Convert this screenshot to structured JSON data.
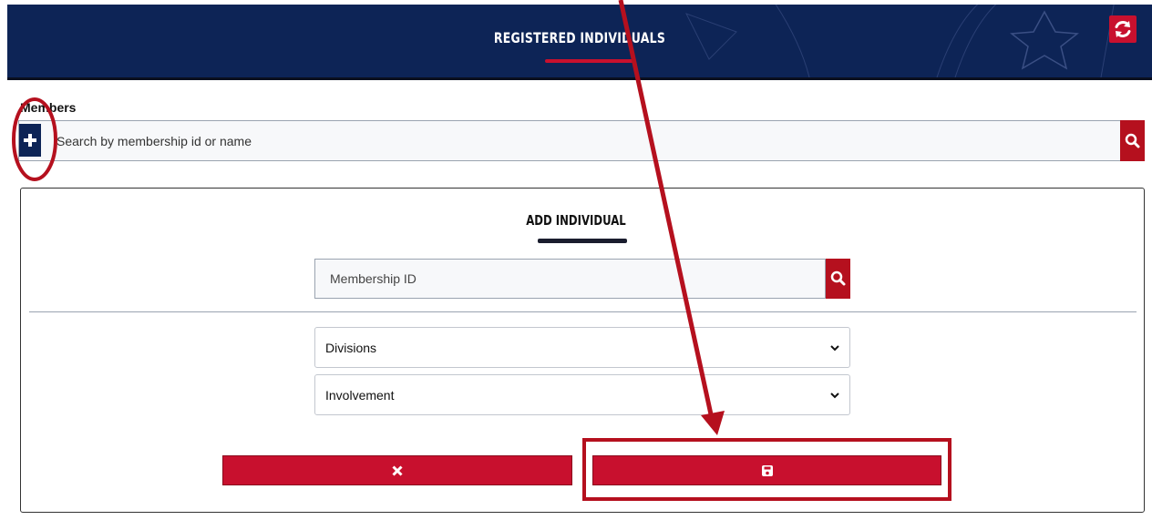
{
  "header": {
    "title": "REGISTERED INDIVIDUALS",
    "refresh_icon": "refresh-icon"
  },
  "members": {
    "label": "Members",
    "search_placeholder": "Search by membership id or name",
    "add_icon": "plus-icon",
    "search_icon": "search-icon"
  },
  "panel": {
    "title": "ADD INDIVIDUAL",
    "membership_placeholder": "Membership ID",
    "search_icon": "search-icon",
    "selects": [
      {
        "label": "Divisions",
        "icon": "chevron-down-icon"
      },
      {
        "label": "Involvement",
        "icon": "chevron-down-icon"
      }
    ],
    "cancel_icon": "close-icon",
    "save_icon": "save-icon"
  },
  "annotations": {
    "color": "#b5101e",
    "circle_target": "add-button",
    "arrow_target": "save-button",
    "box_target": "save-button"
  },
  "colors": {
    "navy": "#0d2456",
    "red": "#c8102e",
    "dark_red": "#b5101e"
  }
}
